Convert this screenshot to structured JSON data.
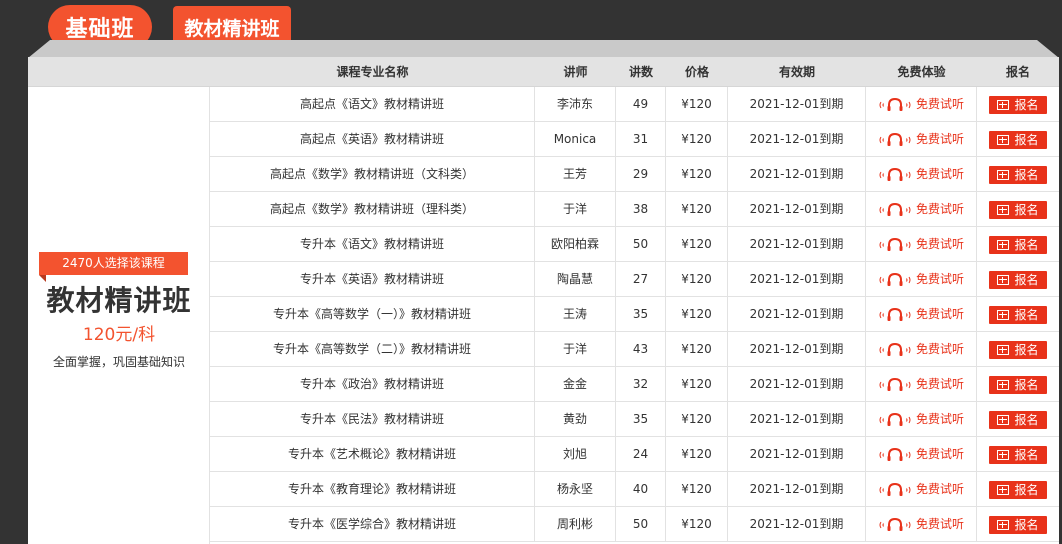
{
  "tabs": {
    "basic": "基础班",
    "textbook": "教材精讲班"
  },
  "columns": [
    "课程专业名称",
    "讲师",
    "讲数",
    "价格",
    "有效期",
    "免费体验",
    "报名"
  ],
  "feature": {
    "ribbon": "2470人选择该课程",
    "title": "教材精讲班",
    "price": "120元/科",
    "desc": "全面掌握，巩固基础知识"
  },
  "accent_color": "#f3532f",
  "rows": [
    {
      "name": "高起点《语文》教材精讲班",
      "teacher": "李沛东",
      "lessons": "49",
      "price": "¥120",
      "valid": "2021-12-01到期",
      "trial": "免费试听",
      "signup": "报名"
    },
    {
      "name": "高起点《英语》教材精讲班",
      "teacher": "Monica",
      "lessons": "31",
      "price": "¥120",
      "valid": "2021-12-01到期",
      "trial": "免费试听",
      "signup": "报名"
    },
    {
      "name": "高起点《数学》教材精讲班（文科类）",
      "teacher": "王芳",
      "lessons": "29",
      "price": "¥120",
      "valid": "2021-12-01到期",
      "trial": "免费试听",
      "signup": "报名"
    },
    {
      "name": "高起点《数学》教材精讲班（理科类）",
      "teacher": "于洋",
      "lessons": "38",
      "price": "¥120",
      "valid": "2021-12-01到期",
      "trial": "免费试听",
      "signup": "报名"
    },
    {
      "name": "专升本《语文》教材精讲班",
      "teacher": "欧阳柏霖",
      "lessons": "50",
      "price": "¥120",
      "valid": "2021-12-01到期",
      "trial": "免费试听",
      "signup": "报名"
    },
    {
      "name": "专升本《英语》教材精讲班",
      "teacher": "陶晶慧",
      "lessons": "27",
      "price": "¥120",
      "valid": "2021-12-01到期",
      "trial": "免费试听",
      "signup": "报名"
    },
    {
      "name": "专升本《高等数学（一）》教材精讲班",
      "teacher": "王涛",
      "lessons": "35",
      "price": "¥120",
      "valid": "2021-12-01到期",
      "trial": "免费试听",
      "signup": "报名"
    },
    {
      "name": "专升本《高等数学（二）》教材精讲班",
      "teacher": "于洋",
      "lessons": "43",
      "price": "¥120",
      "valid": "2021-12-01到期",
      "trial": "免费试听",
      "signup": "报名"
    },
    {
      "name": "专升本《政治》教材精讲班",
      "teacher": "金金",
      "lessons": "32",
      "price": "¥120",
      "valid": "2021-12-01到期",
      "trial": "免费试听",
      "signup": "报名"
    },
    {
      "name": "专升本《民法》教材精讲班",
      "teacher": "黄劲",
      "lessons": "35",
      "price": "¥120",
      "valid": "2021-12-01到期",
      "trial": "免费试听",
      "signup": "报名"
    },
    {
      "name": "专升本《艺术概论》教材精讲班",
      "teacher": "刘旭",
      "lessons": "24",
      "price": "¥120",
      "valid": "2021-12-01到期",
      "trial": "免费试听",
      "signup": "报名"
    },
    {
      "name": "专升本《教育理论》教材精讲班",
      "teacher": "杨永坚",
      "lessons": "40",
      "price": "¥120",
      "valid": "2021-12-01到期",
      "trial": "免费试听",
      "signup": "报名"
    },
    {
      "name": "专升本《医学综合》教材精讲班",
      "teacher": "周利彬",
      "lessons": "50",
      "price": "¥120",
      "valid": "2021-12-01到期",
      "trial": "免费试听",
      "signup": "报名"
    }
  ]
}
